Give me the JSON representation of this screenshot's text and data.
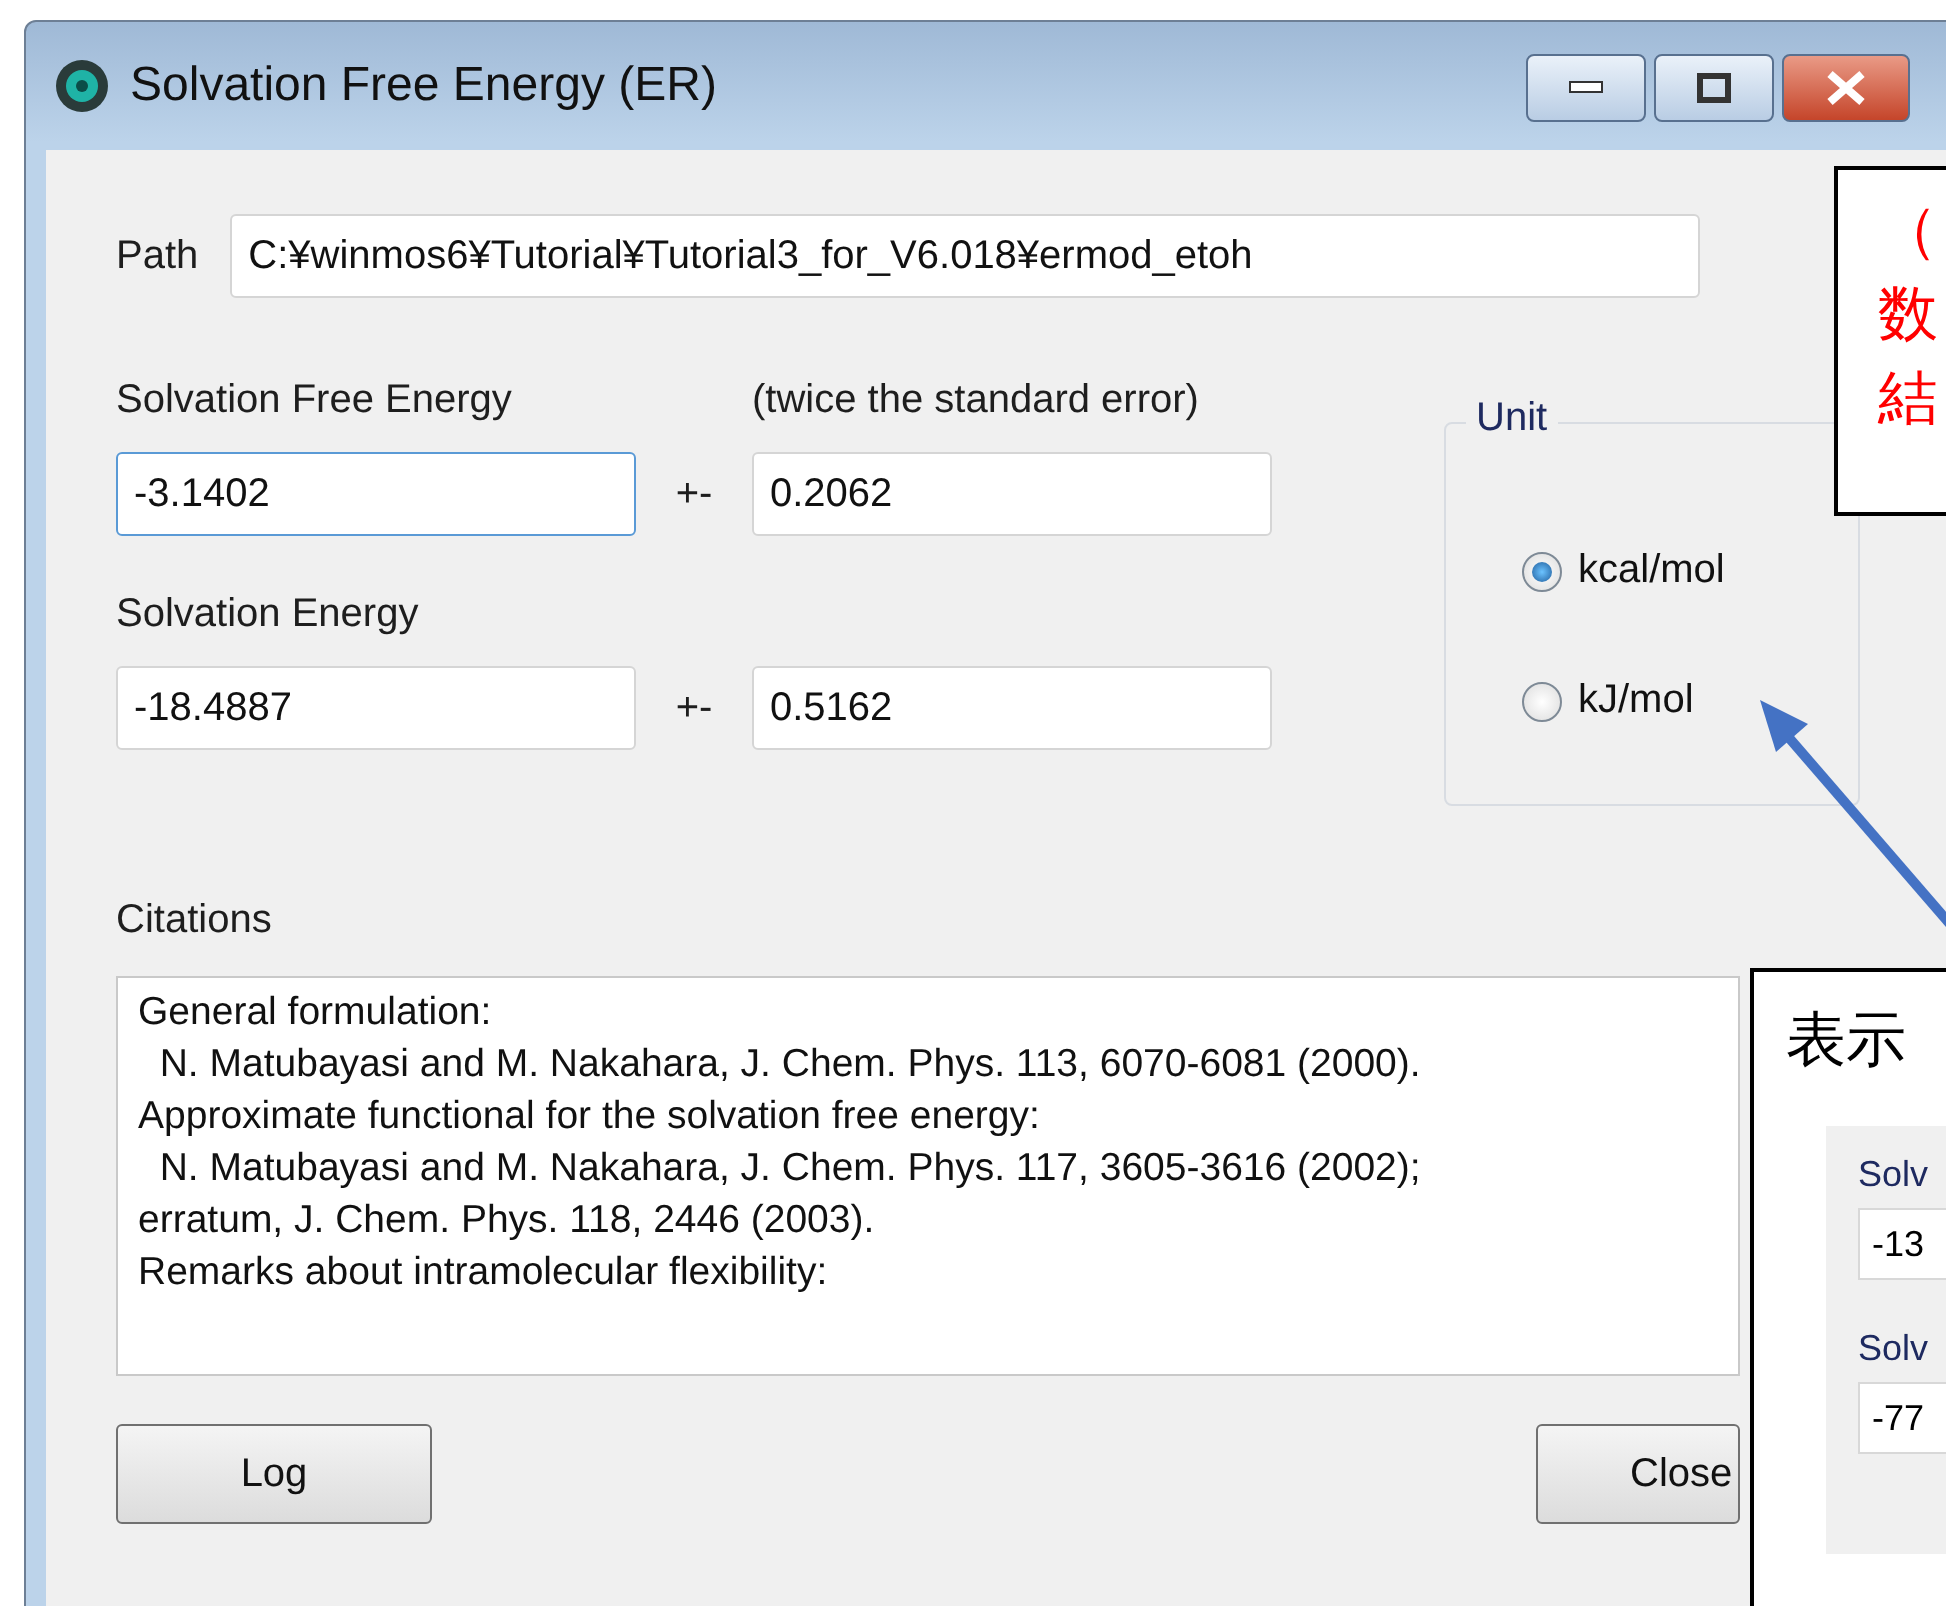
{
  "window": {
    "title": "Solvation Free Energy (ER)"
  },
  "path": {
    "label": "Path",
    "value": "C:¥winmos6¥Tutorial¥Tutorial3_for_V6.018¥ermod_etoh"
  },
  "results": [
    {
      "label": "Solvation Free Energy",
      "value": "-3.1402",
      "separator": "+-",
      "error": "0.2062",
      "error_heading": "(twice the standard error)",
      "focused": true
    },
    {
      "label": "Solvation Energy",
      "value": "-18.4887",
      "separator": "+-",
      "error": "0.5162",
      "focused": false
    }
  ],
  "unit": {
    "label": "Unit",
    "options": [
      {
        "label": "kcal/mol",
        "selected": true
      },
      {
        "label": "kJ/mol",
        "selected": false
      }
    ]
  },
  "citations": {
    "label": "Citations",
    "lines": [
      "General formulation:",
      "  N. Matubayasi and M. Nakahara, J. Chem. Phys. 113, 6070-6081 (2000).",
      "Approximate functional for the solvation free energy:",
      "  N. Matubayasi and M. Nakahara, J. Chem. Phys. 117, 3605-3616 (2002);",
      "erratum, J. Chem. Phys. 118, 2446 (2003).",
      "Remarks about intramolecular flexibility:"
    ]
  },
  "buttons": [
    "Log",
    "Close"
  ],
  "annotations": [
    {
      "kind": "note",
      "lines": [
        "（",
        "数",
        "結"
      ]
    },
    {
      "kind": "inset",
      "heading": "表示",
      "fields": [
        {
          "label": "Solv",
          "value": "-13"
        },
        {
          "label": "Solv",
          "value": "-77"
        }
      ]
    }
  ]
}
